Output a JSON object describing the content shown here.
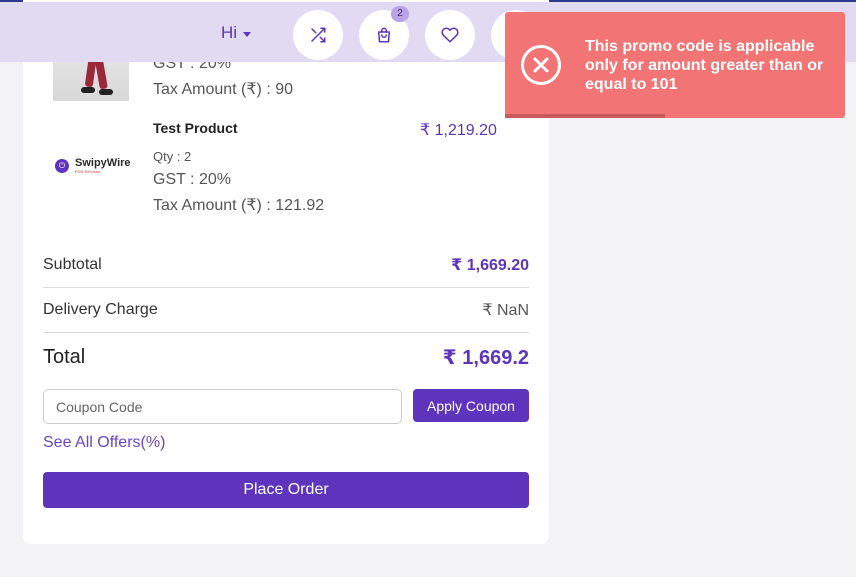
{
  "header": {
    "greeting": "Hi",
    "cart_count": "2",
    "bg_color": "#e2d9f3",
    "icons": [
      "shuffle-icon",
      "shopping-bag-icon",
      "heart-icon",
      "profile-icon"
    ]
  },
  "products": [
    {
      "gst": "GST : 20%",
      "tax": "Tax Amount (₹) : 90"
    },
    {
      "name": "Test Product",
      "price": "₹ 1,219.20",
      "qty": "Qty : 2",
      "gst": "GST : 20%",
      "tax": "Tax Amount (₹) : 121.92",
      "logo_name": "SwipyWire",
      "logo_sub": "POS Services"
    }
  ],
  "summary": {
    "subtotal_label": "Subtotal",
    "subtotal_value": "₹ 1,669.20",
    "delivery_label": "Delivery Charge",
    "delivery_value": "₹ NaN",
    "total_label": "Total",
    "total_value": "₹ 1,669.2"
  },
  "coupon": {
    "placeholder": "Coupon Code",
    "value": "",
    "apply_label": "Apply Coupon",
    "offers_link": "See All Offers(%)"
  },
  "place_order_label": "Place Order",
  "toast": {
    "message": "This promo code is applicable only for amount greater than or equal to 101",
    "remaining": 0.47,
    "color": "#f27474"
  },
  "accent_color": "#5d34bb"
}
